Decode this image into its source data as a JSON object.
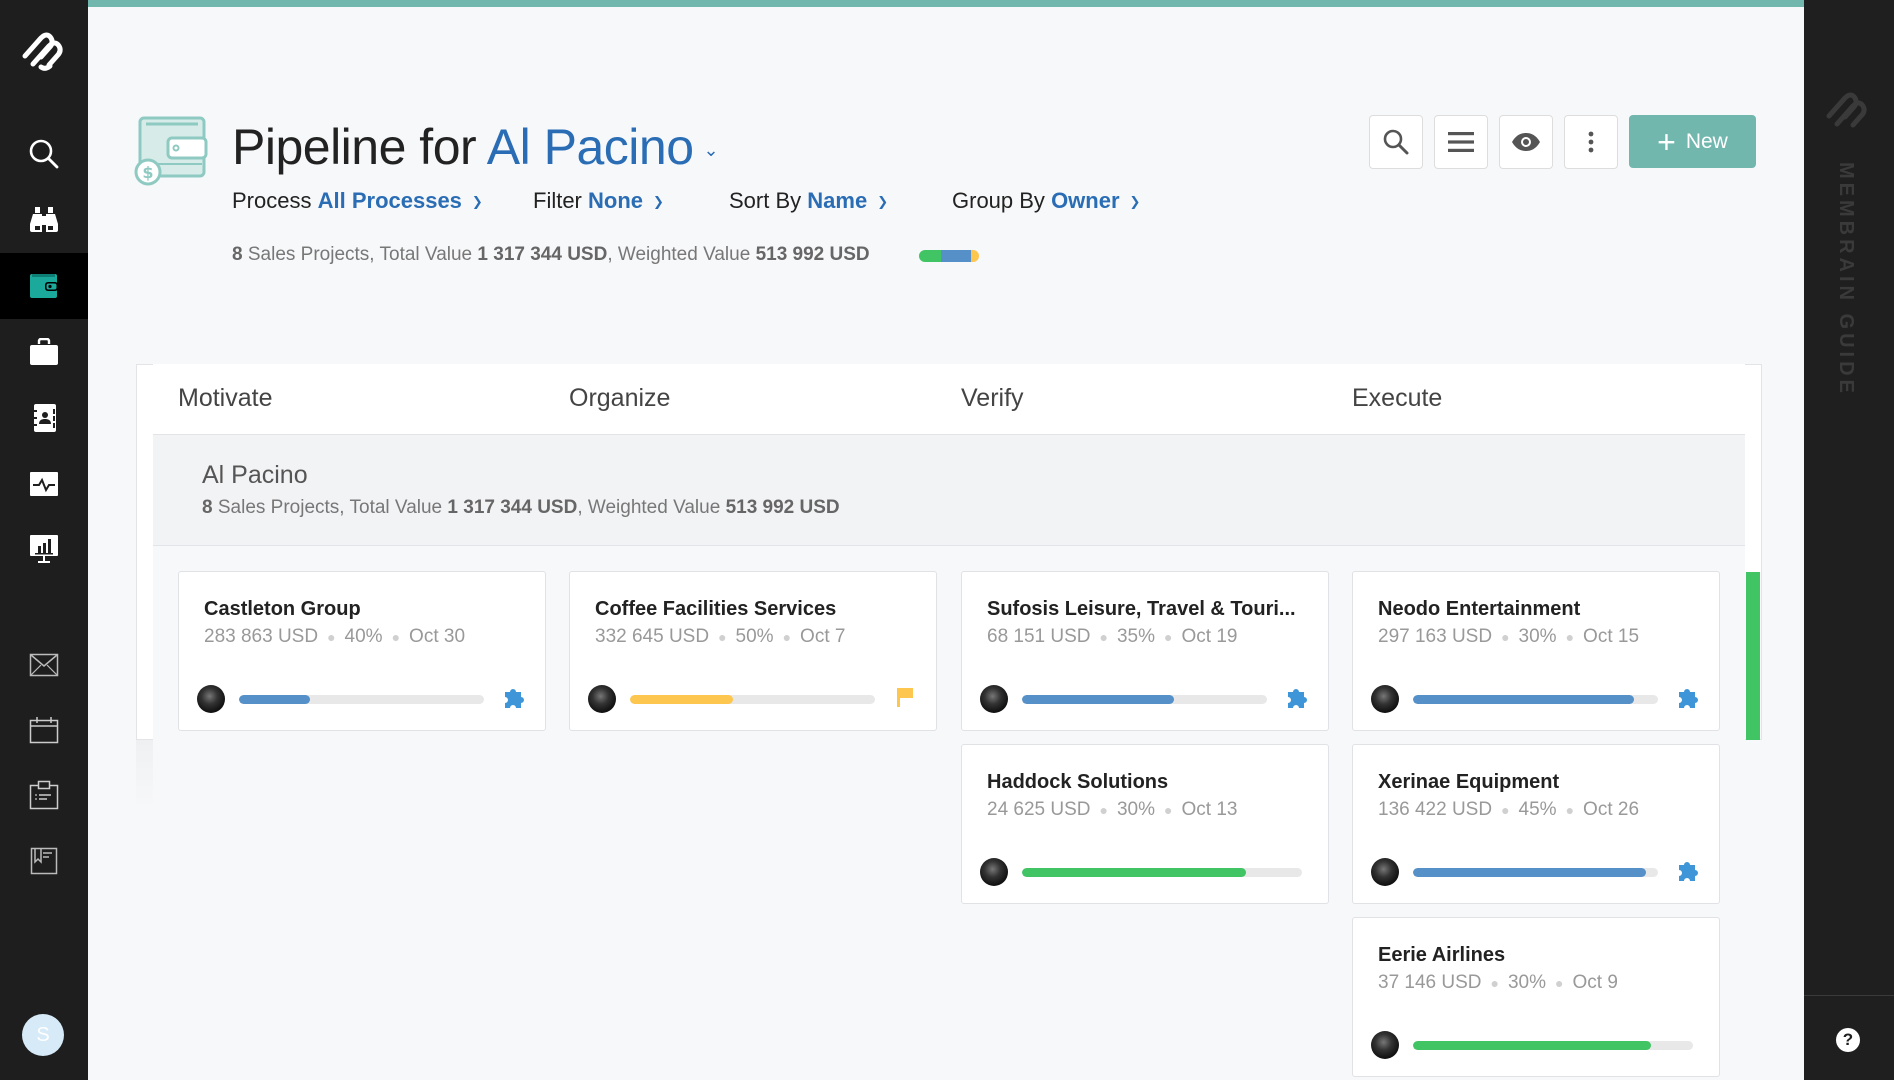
{
  "sidebar": {
    "items": [
      {
        "name": "logo",
        "icon": "membrain-logo-icon"
      },
      {
        "name": "search",
        "icon": "search-icon"
      },
      {
        "name": "prospects",
        "icon": "binoculars-icon"
      },
      {
        "name": "pipeline",
        "icon": "wallet-icon",
        "active": true
      },
      {
        "name": "projects",
        "icon": "briefcase-icon"
      },
      {
        "name": "contacts",
        "icon": "address-book-icon"
      },
      {
        "name": "activity",
        "icon": "pulse-icon"
      },
      {
        "name": "reports",
        "icon": "chart-monitor-icon"
      },
      {
        "name": "email",
        "icon": "envelope-icon"
      },
      {
        "name": "calendar",
        "icon": "calendar-icon"
      },
      {
        "name": "tasks",
        "icon": "clipboard-icon"
      },
      {
        "name": "notes",
        "icon": "bookmark-icon"
      }
    ],
    "user_initial": "S"
  },
  "header": {
    "title_prefix": "Pipeline for",
    "owner": "Al Pacino",
    "filters": [
      {
        "label": "Process",
        "value": "All Processes"
      },
      {
        "label": "Filter",
        "value": "None"
      },
      {
        "label": "Sort By",
        "value": "Name"
      },
      {
        "label": "Group By",
        "value": "Owner"
      }
    ],
    "summary": {
      "count": "8",
      "count_label": "Sales Projects, Total Value",
      "total": "1 317 344 USD",
      "weighted_label": ", Weighted Value",
      "weighted": "513 992 USD"
    },
    "summary_bar": [
      {
        "color": "#41c464",
        "fraction": 0.36
      },
      {
        "color": "#5591c8",
        "fraction": 0.5
      },
      {
        "color": "#fdc64f",
        "fraction": 0.14
      }
    ],
    "toolbar": {
      "search": "search-icon",
      "list": "list-icon",
      "view": "eye-icon",
      "more": "more-vertical-icon",
      "new_label": "New"
    }
  },
  "board": {
    "columns": [
      "Motivate",
      "Organize",
      "Verify",
      "Execute"
    ],
    "group": {
      "name": "Al Pacino",
      "count": "8",
      "count_label": "Sales Projects, Total Value",
      "total": "1 317 344 USD",
      "weighted_label": ", Weighted Value",
      "weighted": "513 992 USD"
    },
    "cards": [
      {
        "column": 0,
        "row": 0,
        "name": "Castleton Group",
        "value": "283 863 USD",
        "probability": "40%",
        "date": "Oct 30",
        "progress": 0.29,
        "bar_color": "#5591c8",
        "icon": "puzzle-icon",
        "icon_color": "#3e96d8"
      },
      {
        "column": 1,
        "row": 0,
        "name": "Coffee Facilities Services",
        "value": "332 645 USD",
        "probability": "50%",
        "date": "Oct 7",
        "progress": 0.42,
        "bar_color": "#fdc64f",
        "icon": "flag-icon",
        "icon_color": "#fdc64f"
      },
      {
        "column": 2,
        "row": 0,
        "name": "Sufosis Leisure, Travel & Touri...",
        "value": "68 151 USD",
        "probability": "35%",
        "date": "Oct 19",
        "progress": 0.62,
        "bar_color": "#5591c8",
        "icon": "puzzle-icon",
        "icon_color": "#3e96d8"
      },
      {
        "column": 3,
        "row": 0,
        "name": "Neodo Entertainment",
        "value": "297 163 USD",
        "probability": "30%",
        "date": "Oct 15",
        "progress": 0.9,
        "bar_color": "#5591c8",
        "icon": "puzzle-icon",
        "icon_color": "#3e96d8"
      },
      {
        "column": 2,
        "row": 1,
        "name": "Haddock Solutions",
        "value": "24 625 USD",
        "probability": "30%",
        "date": "Oct 13",
        "progress": 0.8,
        "bar_color": "#41c464",
        "icon": null
      },
      {
        "column": 3,
        "row": 1,
        "name": "Xerinae Equipment",
        "value": "136 422 USD",
        "probability": "45%",
        "date": "Oct 26",
        "progress": 0.95,
        "bar_color": "#5591c8",
        "icon": "puzzle-icon",
        "icon_color": "#3e96d8"
      },
      {
        "column": 3,
        "row": 2,
        "name": "Eerie Airlines",
        "value": "37 146 USD",
        "probability": "30%",
        "date": "Oct 9",
        "progress": 0.85,
        "bar_color": "#41c464",
        "icon": null
      }
    ]
  },
  "guide": {
    "label": "MEMBRAIN GUIDE",
    "help": "?"
  },
  "colors": {
    "accent": "#72b7ae",
    "link": "#2a6db5",
    "sidebar_bg": "#1e1e1e",
    "active_icon": "#1aa99a"
  }
}
